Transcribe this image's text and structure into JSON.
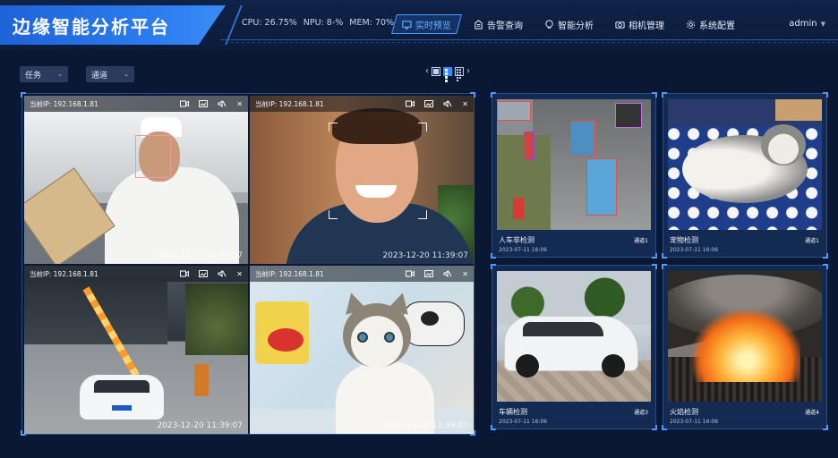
{
  "header": {
    "title": "边缘智能分析平台",
    "stats": {
      "cpu": "CPU: 26.75%",
      "npu": "NPU: 8-%",
      "mem": "MEM: 70%"
    },
    "nav": [
      {
        "label": "实时预览",
        "icon": "monitor-icon",
        "active": true
      },
      {
        "label": "告警查询",
        "icon": "alert-list-icon",
        "active": false
      },
      {
        "label": "智能分析",
        "icon": "brain-icon",
        "active": false
      },
      {
        "label": "相机管理",
        "icon": "camera-icon",
        "active": false
      },
      {
        "label": "系统配置",
        "icon": "gear-icon",
        "active": false
      }
    ],
    "user": "admin"
  },
  "toolbar": {
    "task_select": "任务",
    "channel_select": "通道",
    "layout_options": [
      "1x1",
      "2x2",
      "3x3"
    ],
    "layout_selected": "2x2"
  },
  "video_cells": [
    {
      "ip_label": "当前IP: 192.168.1.81",
      "timestamp": "2023-12-20 11:39:07"
    },
    {
      "ip_label": "当前IP: 192.168.1.81",
      "timestamp": "2023-12-20 11:39:07"
    },
    {
      "ip_label": "当前IP: 192.168.1.81",
      "timestamp": "2023-12-20 11:39:07"
    },
    {
      "ip_label": "当前IP: 192.168.1.81",
      "timestamp": "2023-12-20 11:39:07"
    }
  ],
  "detections": [
    {
      "title": "人车非检测",
      "time": "2023-07-11 16:06",
      "channel": "通道1"
    },
    {
      "title": "宠物检测",
      "time": "2023-07-11 16:06",
      "channel": "通道1"
    },
    {
      "title": "车辆检测",
      "time": "2023-07-11 16:06",
      "channel": "通道3"
    },
    {
      "title": "火焰检测",
      "time": "2023-07-11 16:06",
      "channel": "通道4"
    }
  ],
  "colors": {
    "background": "#0b1833",
    "brand": "#2c7df0",
    "accent": "#4d9bff",
    "panel_border": "#2a4c87",
    "detect_box": "#e0514a"
  }
}
